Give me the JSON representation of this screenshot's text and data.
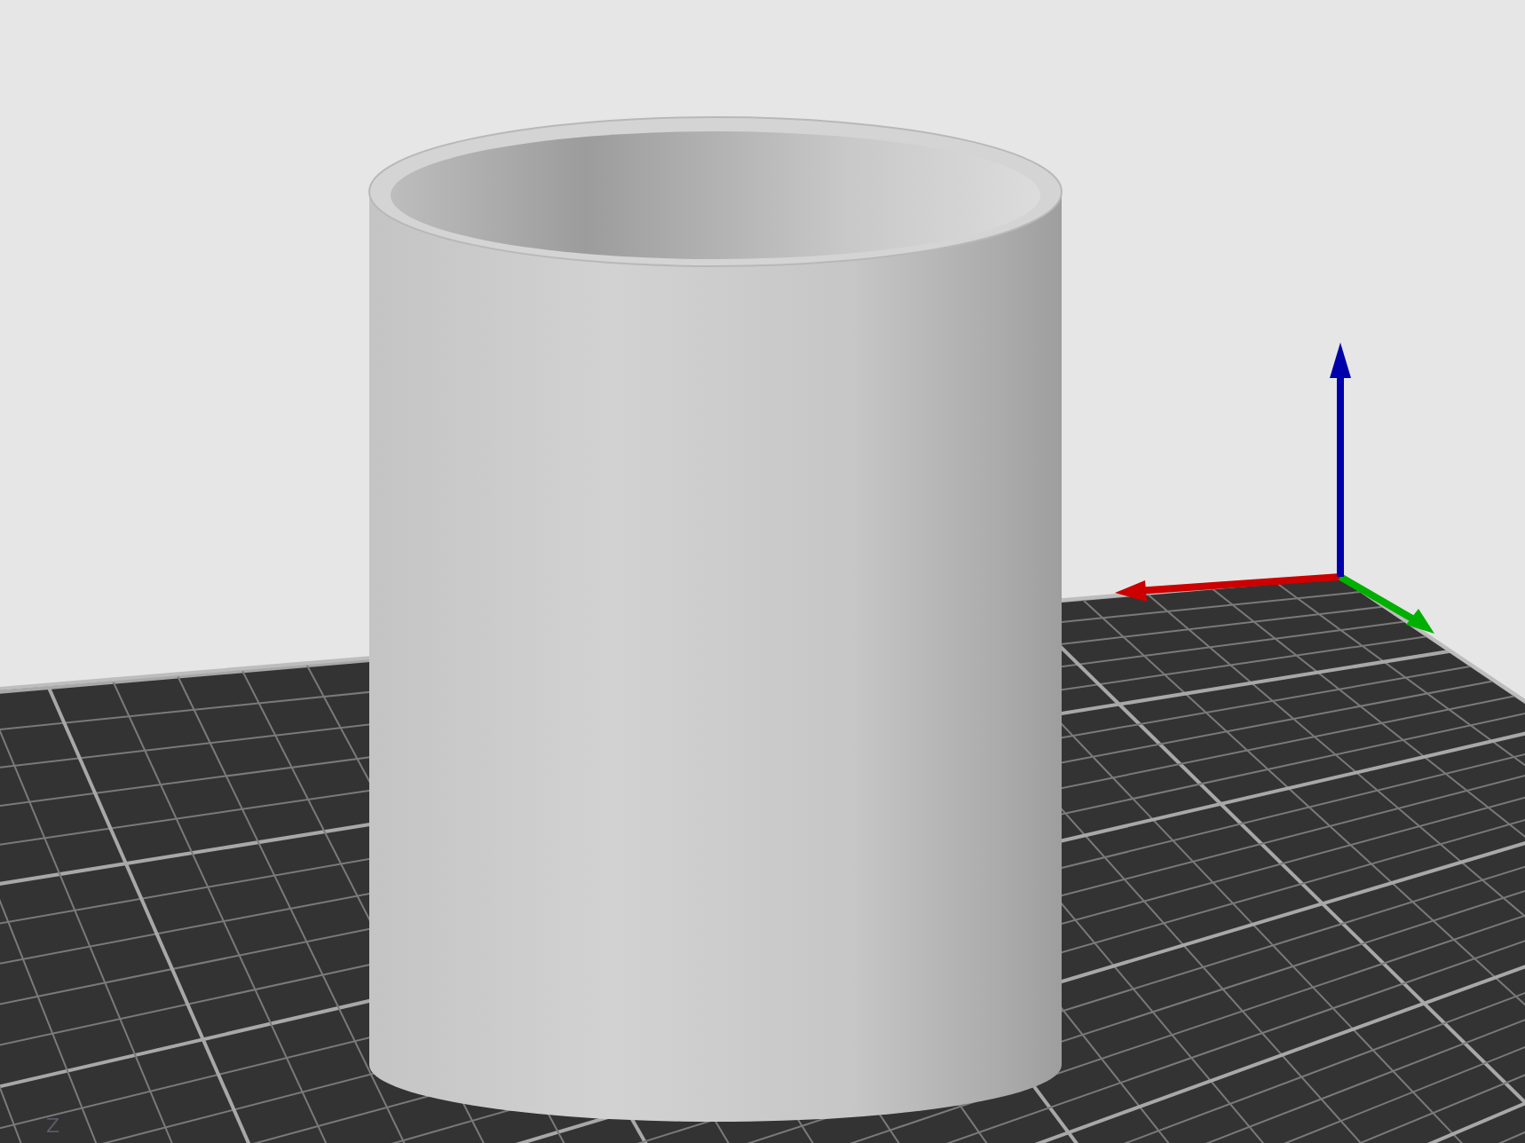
{
  "viewport": {
    "bed_label": "Z",
    "axes": [
      {
        "kind": "x",
        "color": "#cc0000"
      },
      {
        "kind": "y",
        "color": "#00b000"
      },
      {
        "kind": "z",
        "color": "#0000aa"
      }
    ]
  }
}
